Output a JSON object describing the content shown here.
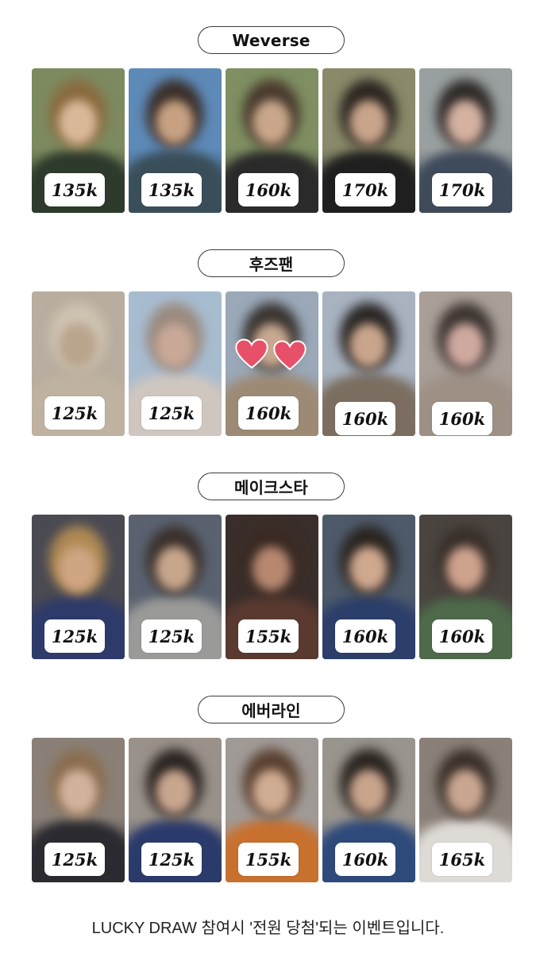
{
  "sections": [
    {
      "title": "Weverse",
      "cards": [
        {
          "price": "135k",
          "bg": "#7d8a60",
          "hair": "#8a6a3e",
          "skin": "#d9b89a",
          "cloth": "#2d3a2c"
        },
        {
          "price": "135k",
          "bg": "#5e8ab8",
          "hair": "#3b2f2a",
          "skin": "#c7a182",
          "cloth": "#3a4e5a"
        },
        {
          "price": "160k",
          "bg": "#7f8f62",
          "hair": "#4a3a2e",
          "skin": "#caa78a",
          "cloth": "#2a2a2a"
        },
        {
          "price": "170k",
          "bg": "#8a8a6a",
          "hair": "#2b2520",
          "skin": "#c8a48a",
          "cloth": "#1f1f1f"
        },
        {
          "price": "170k",
          "bg": "#9aa0a0",
          "hair": "#2f2a28",
          "skin": "#d4b1a0",
          "cloth": "#3f4a5a"
        }
      ]
    },
    {
      "title": "후즈팬",
      "cards": [
        {
          "price": "125k",
          "bg": "#b8ad9e",
          "hair": "#cfc3b2",
          "skin": "#b9a48c",
          "cloth": "#bfb2a0"
        },
        {
          "price": "125k",
          "bg": "#a8bcd0",
          "hair": "#9a8a7e",
          "skin": "#c9a898",
          "cloth": "#cfc6bf"
        },
        {
          "price": "160k",
          "bg": "#9aa8b8",
          "hair": "#3a3430",
          "skin": "#c8a890",
          "cloth": "#9d8a74"
        },
        {
          "price": "160k",
          "bg": "#a8b2c0",
          "hair": "#2a2624",
          "skin": "#c9a58c",
          "cloth": "#7b6e60"
        },
        {
          "price": "160k",
          "bg": "#a99f97",
          "hair": "#3d3531",
          "skin": "#cfa9a0",
          "cloth": "#9e9085"
        }
      ]
    },
    {
      "title": "메이크스타",
      "cards": [
        {
          "price": "125k",
          "bg": "#4a4a52",
          "hair": "#b08a54",
          "skin": "#d0a584",
          "cloth": "#2e3a6a"
        },
        {
          "price": "125k",
          "bg": "#5a6270",
          "hair": "#3a302c",
          "skin": "#c8a68c",
          "cloth": "#9a9a98"
        },
        {
          "price": "155k",
          "bg": "#3a2e2a",
          "hair": "#3a2a22",
          "skin": "#b68870",
          "cloth": "#5a3a30"
        },
        {
          "price": "160k",
          "bg": "#4e5a6a",
          "hair": "#2a2420",
          "skin": "#cfa88e",
          "cloth": "#2c3e6a"
        },
        {
          "price": "160k",
          "bg": "#4a4440",
          "hair": "#3a302a",
          "skin": "#cfa28e",
          "cloth": "#4e6a4a"
        }
      ]
    },
    {
      "title": "에버라인",
      "cards": [
        {
          "price": "125k",
          "bg": "#8a8078",
          "hair": "#8a6e50",
          "skin": "#d2b29c",
          "cloth": "#2a2a30"
        },
        {
          "price": "125k",
          "bg": "#9a928a",
          "hair": "#2a2422",
          "skin": "#c9a68e",
          "cloth": "#2a3a6a"
        },
        {
          "price": "155k",
          "bg": "#a09a96",
          "hair": "#5a4030",
          "skin": "#d0ac92",
          "cloth": "#c8702e"
        },
        {
          "price": "160k",
          "bg": "#9a948e",
          "hair": "#2a2420",
          "skin": "#c8a48c",
          "cloth": "#2e4a7a"
        },
        {
          "price": "165k",
          "bg": "#8a8078",
          "hair": "#3a302a",
          "skin": "#caa690",
          "cloth": "#dedad6"
        }
      ]
    }
  ],
  "hearts_color": "#e8506a",
  "footer": "LUCKY DRAW 참여시 '전원 당첨'되는 이벤트입니다."
}
